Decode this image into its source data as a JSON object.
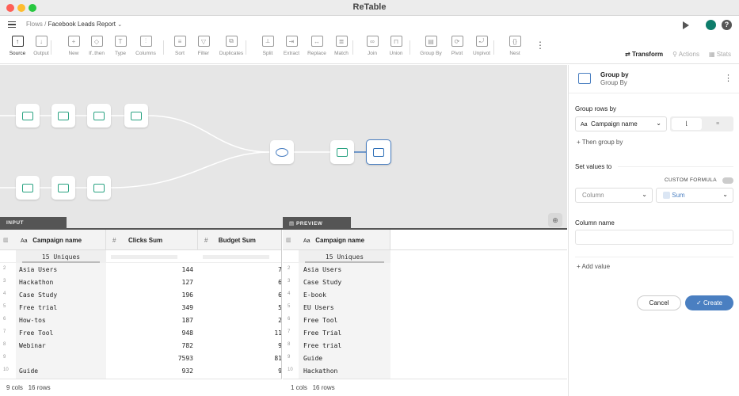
{
  "app": {
    "title": "ReTable"
  },
  "breadcrumb": {
    "root": "Flows",
    "sep": "/",
    "page": "Facebook Leads Report"
  },
  "toolbar": [
    {
      "label": "Source",
      "icon": "source-icon",
      "active": true
    },
    {
      "label": "Output",
      "icon": "output-icon"
    },
    {
      "label": "New",
      "icon": "new-icon"
    },
    {
      "label": "If..then",
      "icon": "if-then-icon"
    },
    {
      "label": "Type",
      "icon": "type-icon"
    },
    {
      "label": "Columns",
      "icon": "columns-icon"
    },
    {
      "label": "Sort",
      "icon": "sort-icon"
    },
    {
      "label": "Filter",
      "icon": "filter-icon"
    },
    {
      "label": "Duplicates",
      "icon": "duplicates-icon"
    },
    {
      "label": "Split",
      "icon": "split-icon"
    },
    {
      "label": "Extract",
      "icon": "extract-icon"
    },
    {
      "label": "Replace",
      "icon": "replace-icon"
    },
    {
      "label": "Match",
      "icon": "match-icon"
    },
    {
      "label": "Join",
      "icon": "join-icon"
    },
    {
      "label": "Union",
      "icon": "union-icon"
    },
    {
      "label": "Group By",
      "icon": "group-by-icon"
    },
    {
      "label": "Pivot",
      "icon": "pivot-icon"
    },
    {
      "label": "Unpivot",
      "icon": "unpivot-icon"
    },
    {
      "label": "Nest",
      "icon": "nest-icon"
    }
  ],
  "right_tabs": {
    "transform": "Transform",
    "actions": "Actions",
    "stats": "Stats"
  },
  "panel": {
    "title": "Group by",
    "subtitle": "Group By",
    "group_rows_label": "Group rows by",
    "group_field": "Campaign name",
    "then_group": "Then group by",
    "set_values_label": "Set values to",
    "custom_formula": "CUSTOM FORMULA",
    "column_placeholder": "Column",
    "agg": "Sum",
    "column_name_label": "Column name",
    "add_value": "Add value",
    "cancel": "Cancel",
    "create": "Create"
  },
  "input": {
    "tab": "INPUT",
    "columns": [
      "Campaign name",
      "Clicks Sum",
      "Budget Sum"
    ],
    "uniques": "15 Uniques",
    "rows": [
      [
        "2",
        "Asia Users",
        "144",
        "7"
      ],
      [
        "3",
        "Hackathon",
        "127",
        "6"
      ],
      [
        "4",
        "Case Study",
        "196",
        "6"
      ],
      [
        "5",
        "Free trial",
        "349",
        "5"
      ],
      [
        "6",
        "How-tos",
        "187",
        "2"
      ],
      [
        "7",
        "Free Tool",
        "948",
        "11"
      ],
      [
        "8",
        "Webinar",
        "782",
        "9"
      ],
      [
        "9",
        "",
        "7593",
        "81"
      ],
      [
        "10",
        "Guide",
        "932",
        "9"
      ]
    ],
    "footer_cols": "9 cols",
    "footer_rows": "16 rows"
  },
  "preview": {
    "tab": "PREVIEW",
    "column": "Campaign name",
    "uniques": "15 Uniques",
    "rows": [
      [
        "2",
        "Asia Users"
      ],
      [
        "3",
        "Case Study"
      ],
      [
        "4",
        "E-book"
      ],
      [
        "5",
        "EU Users"
      ],
      [
        "6",
        "Free Tool"
      ],
      [
        "7",
        "Free Trial"
      ],
      [
        "8",
        "Free trial"
      ],
      [
        "9",
        "Guide"
      ],
      [
        "10",
        "Hackathon"
      ]
    ],
    "footer_cols": "1 cols",
    "footer_rows": "16 rows"
  },
  "colors": {
    "accent": "#4a7fc1",
    "node_green": "#2aa382",
    "create_btn": "#4a7fc1"
  }
}
